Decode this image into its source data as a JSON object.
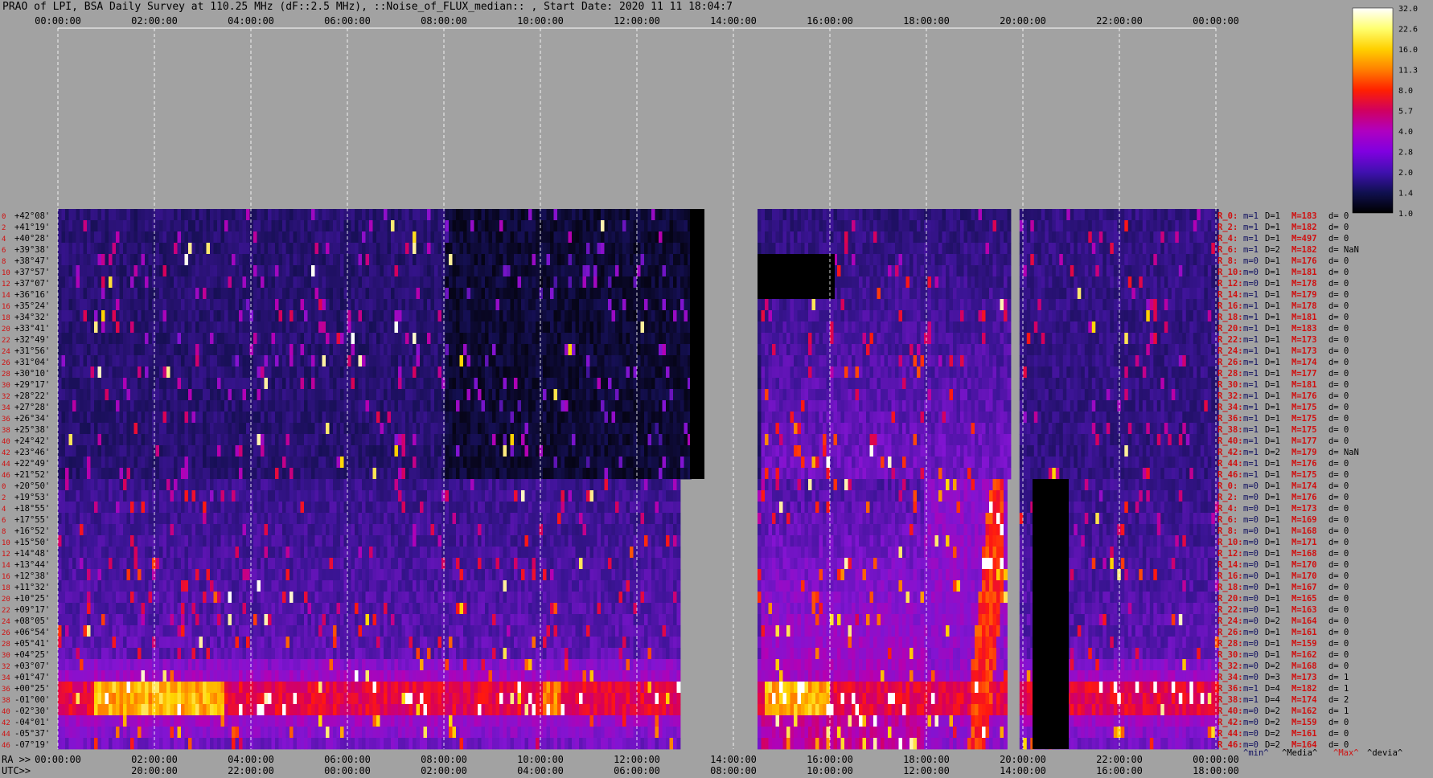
{
  "title": "PRAO of LPI, BSA Daily Survey at 110.25 MHz (dF::2.5 MHz), ::Noise_of_FLUX_median:: , Start Date: 2020 11 11 18:04:7",
  "axes": {
    "ra_axis_name": "RA >>",
    "utc_axis_name": "UTC>>",
    "top_ticks": [
      "00:00:00",
      "02:00:00",
      "04:00:00",
      "06:00:00",
      "08:00:00",
      "10:00:00",
      "12:00:00",
      "14:00:00",
      "16:00:00",
      "18:00:00",
      "20:00:00",
      "22:00:00",
      "00:00:00"
    ],
    "ra_ticks": [
      "00:00:00",
      "02:00:00",
      "04:00:00",
      "06:00:00",
      "08:00:00",
      "10:00:00",
      "12:00:00",
      "14:00:00",
      "16:00:00",
      "18:00:00",
      "20:00:00",
      "22:00:00",
      "00:00:00"
    ],
    "utc_ticks": [
      "20:00:00",
      "22:00:00",
      "00:00:00",
      "02:00:00",
      "04:00:00",
      "06:00:00",
      "08:00:00",
      "10:00:00",
      "12:00:00",
      "14:00:00",
      "16:00:00",
      "18:00:00"
    ]
  },
  "colorbar": {
    "labels": [
      "32.0",
      "22.6",
      "16.0",
      "11.3",
      "8.0",
      "5.7",
      "4.0",
      "2.8",
      "2.0",
      "1.4",
      "1.0"
    ],
    "colors": [
      "#ffffff",
      "#ffff70",
      "#ffd000",
      "#ff8000",
      "#ff2000",
      "#d00060",
      "#b000c0",
      "#8000e0",
      "#4010b0",
      "#101050",
      "#000000"
    ]
  },
  "stats_legend": {
    "min_label": "^min^",
    "median_label": "^Media^",
    "max_label": "^Max^",
    "dev_label": "^devia^"
  },
  "chart_data": {
    "type": "heatmap",
    "title": "PRAO of LPI, BSA Daily Survey at 110.25 MHz (dF::2.5 MHz), ::Noise_of_FLUX_median:: , Start Date: 2020 11 11 18:04:7",
    "xlabel": "RA / UTC",
    "x_range_hours": [
      0,
      24
    ],
    "color_scale": [
      1.0,
      32.0
    ],
    "declinations": [
      "+42°08'",
      "+41°19'",
      "+40°28'",
      "+39°38'",
      "+38°47'",
      "+37°57'",
      "+37°07'",
      "+36°16'",
      "+35°24'",
      "+34°32'",
      "+33°41'",
      "+32°49'",
      "+31°56'",
      "+31°04'",
      "+30°10'",
      "+29°17'",
      "+28°22'",
      "+27°28'",
      "+26°34'",
      "+25°38'",
      "+24°42'",
      "+23°46'",
      "+22°49'",
      "+21°52'",
      "+20°50'",
      "+19°53'",
      "+18°55'",
      "+17°55'",
      "+16°52'",
      "+15°50'",
      "+14°48'",
      "+13°44'",
      "+12°38'",
      "+11°32'",
      "+10°25'",
      "+09°17'",
      "+08°05'",
      "+06°54'",
      "+05°41'",
      "+04°25'",
      "+03°07'",
      "+01°47'",
      "+00°25'",
      "-01°00'",
      "-02°30'",
      "-04°01'",
      "-05°37'",
      "-07°19'"
    ],
    "row_numbers": [
      "0",
      "2",
      "4",
      "6",
      "8",
      "10",
      "12",
      "14",
      "16",
      "18",
      "20",
      "22",
      "24",
      "26",
      "28",
      "30",
      "32",
      "34",
      "36",
      "38",
      "40",
      "42",
      "44",
      "46",
      "0",
      "2",
      "4",
      "6",
      "8",
      "10",
      "12",
      "14",
      "16",
      "18",
      "20",
      "22",
      "24",
      "26",
      "28",
      "30",
      "32",
      "34",
      "36",
      "38",
      "40",
      "42",
      "44",
      "46"
    ],
    "row_stats": [
      {
        "r": "R_0:",
        "m": "m=1",
        "d": "D=1",
        "M": "M=183",
        "dev": "d= 0"
      },
      {
        "r": "R_2:",
        "m": "m=1",
        "d": "D=1",
        "M": "M=182",
        "dev": "d= 0"
      },
      {
        "r": "R_4:",
        "m": "m=1",
        "d": "D=1",
        "M": "M=497",
        "dev": "d= 0"
      },
      {
        "r": "R_6:",
        "m": "m=1",
        "d": "D=2",
        "M": "M=182",
        "dev": "d= NaN"
      },
      {
        "r": "R_8:",
        "m": "m=0",
        "d": "D=1",
        "M": "M=176",
        "dev": "d= 0"
      },
      {
        "r": "R_10:",
        "m": "m=0",
        "d": "D=1",
        "M": "M=181",
        "dev": "d= 0"
      },
      {
        "r": "R_12:",
        "m": "m=0",
        "d": "D=1",
        "M": "M=178",
        "dev": "d= 0"
      },
      {
        "r": "R_14:",
        "m": "m=1",
        "d": "D=1",
        "M": "M=179",
        "dev": "d= 0"
      },
      {
        "r": "R_16:",
        "m": "m=1",
        "d": "D=1",
        "M": "M=178",
        "dev": "d= 0"
      },
      {
        "r": "R_18:",
        "m": "m=1",
        "d": "D=1",
        "M": "M=181",
        "dev": "d= 0"
      },
      {
        "r": "R_20:",
        "m": "m=1",
        "d": "D=1",
        "M": "M=183",
        "dev": "d= 0"
      },
      {
        "r": "R_22:",
        "m": "m=1",
        "d": "D=1",
        "M": "M=173",
        "dev": "d= 0"
      },
      {
        "r": "R_24:",
        "m": "m=1",
        "d": "D=1",
        "M": "M=173",
        "dev": "d= 0"
      },
      {
        "r": "R_26:",
        "m": "m=1",
        "d": "D=1",
        "M": "M=174",
        "dev": "d= 0"
      },
      {
        "r": "R_28:",
        "m": "m=1",
        "d": "D=1",
        "M": "M=177",
        "dev": "d= 0"
      },
      {
        "r": "R_30:",
        "m": "m=1",
        "d": "D=1",
        "M": "M=181",
        "dev": "d= 0"
      },
      {
        "r": "R_32:",
        "m": "m=1",
        "d": "D=1",
        "M": "M=176",
        "dev": "d= 0"
      },
      {
        "r": "R_34:",
        "m": "m=1",
        "d": "D=1",
        "M": "M=175",
        "dev": "d= 0"
      },
      {
        "r": "R_36:",
        "m": "m=1",
        "d": "D=1",
        "M": "M=175",
        "dev": "d= 0"
      },
      {
        "r": "R_38:",
        "m": "m=1",
        "d": "D=1",
        "M": "M=175",
        "dev": "d= 0"
      },
      {
        "r": "R_40:",
        "m": "m=1",
        "d": "D=1",
        "M": "M=177",
        "dev": "d= 0"
      },
      {
        "r": "R_42:",
        "m": "m=1",
        "d": "D=2",
        "M": "M=179",
        "dev": "d= NaN"
      },
      {
        "r": "R_44:",
        "m": "m=1",
        "d": "D=1",
        "M": "M=176",
        "dev": "d= 0"
      },
      {
        "r": "R_46:",
        "m": "m=1",
        "d": "D=1",
        "M": "M=175",
        "dev": "d= 0"
      },
      {
        "r": "R_0:",
        "m": "m=0",
        "d": "D=1",
        "M": "M=174",
        "dev": "d= 0"
      },
      {
        "r": "R_2:",
        "m": "m=0",
        "d": "D=1",
        "M": "M=176",
        "dev": "d= 0"
      },
      {
        "r": "R_4:",
        "m": "m=0",
        "d": "D=1",
        "M": "M=173",
        "dev": "d= 0"
      },
      {
        "r": "R_6:",
        "m": "m=0",
        "d": "D=1",
        "M": "M=169",
        "dev": "d= 0"
      },
      {
        "r": "R_8:",
        "m": "m=0",
        "d": "D=1",
        "M": "M=168",
        "dev": "d= 0"
      },
      {
        "r": "R_10:",
        "m": "m=0",
        "d": "D=1",
        "M": "M=171",
        "dev": "d= 0"
      },
      {
        "r": "R_12:",
        "m": "m=0",
        "d": "D=1",
        "M": "M=168",
        "dev": "d= 0"
      },
      {
        "r": "R_14:",
        "m": "m=0",
        "d": "D=1",
        "M": "M=170",
        "dev": "d= 0"
      },
      {
        "r": "R_16:",
        "m": "m=0",
        "d": "D=1",
        "M": "M=170",
        "dev": "d= 0"
      },
      {
        "r": "R_18:",
        "m": "m=0",
        "d": "D=1",
        "M": "M=167",
        "dev": "d= 0"
      },
      {
        "r": "R_20:",
        "m": "m=0",
        "d": "D=1",
        "M": "M=165",
        "dev": "d= 0"
      },
      {
        "r": "R_22:",
        "m": "m=0",
        "d": "D=1",
        "M": "M=163",
        "dev": "d= 0"
      },
      {
        "r": "R_24:",
        "m": "m=0",
        "d": "D=2",
        "M": "M=164",
        "dev": "d= 0"
      },
      {
        "r": "R_26:",
        "m": "m=0",
        "d": "D=1",
        "M": "M=161",
        "dev": "d= 0"
      },
      {
        "r": "R_28:",
        "m": "m=0",
        "d": "D=1",
        "M": "M=159",
        "dev": "d= 0"
      },
      {
        "r": "R_30:",
        "m": "m=0",
        "d": "D=1",
        "M": "M=162",
        "dev": "d= 0"
      },
      {
        "r": "R_32:",
        "m": "m=0",
        "d": "D=2",
        "M": "M=168",
        "dev": "d= 0"
      },
      {
        "r": "R_34:",
        "m": "m=0",
        "d": "D=3",
        "M": "M=173",
        "dev": "d= 1"
      },
      {
        "r": "R_36:",
        "m": "m=1",
        "d": "D=4",
        "M": "M=182",
        "dev": "d= 1"
      },
      {
        "r": "R_38:",
        "m": "m=1",
        "d": "D=4",
        "M": "M=174",
        "dev": "d= 2"
      },
      {
        "r": "R_40:",
        "m": "m=0",
        "d": "D=2",
        "M": "M=162",
        "dev": "d= 1"
      },
      {
        "r": "R_42:",
        "m": "m=0",
        "d": "D=2",
        "M": "M=159",
        "dev": "d= 0"
      },
      {
        "r": "R_44:",
        "m": "m=0",
        "d": "D=2",
        "M": "M=161",
        "dev": "d= 0"
      },
      {
        "r": "R_46:",
        "m": "m=0",
        "d": "D=2",
        "M": "M=164",
        "dev": "d= 0"
      }
    ]
  }
}
